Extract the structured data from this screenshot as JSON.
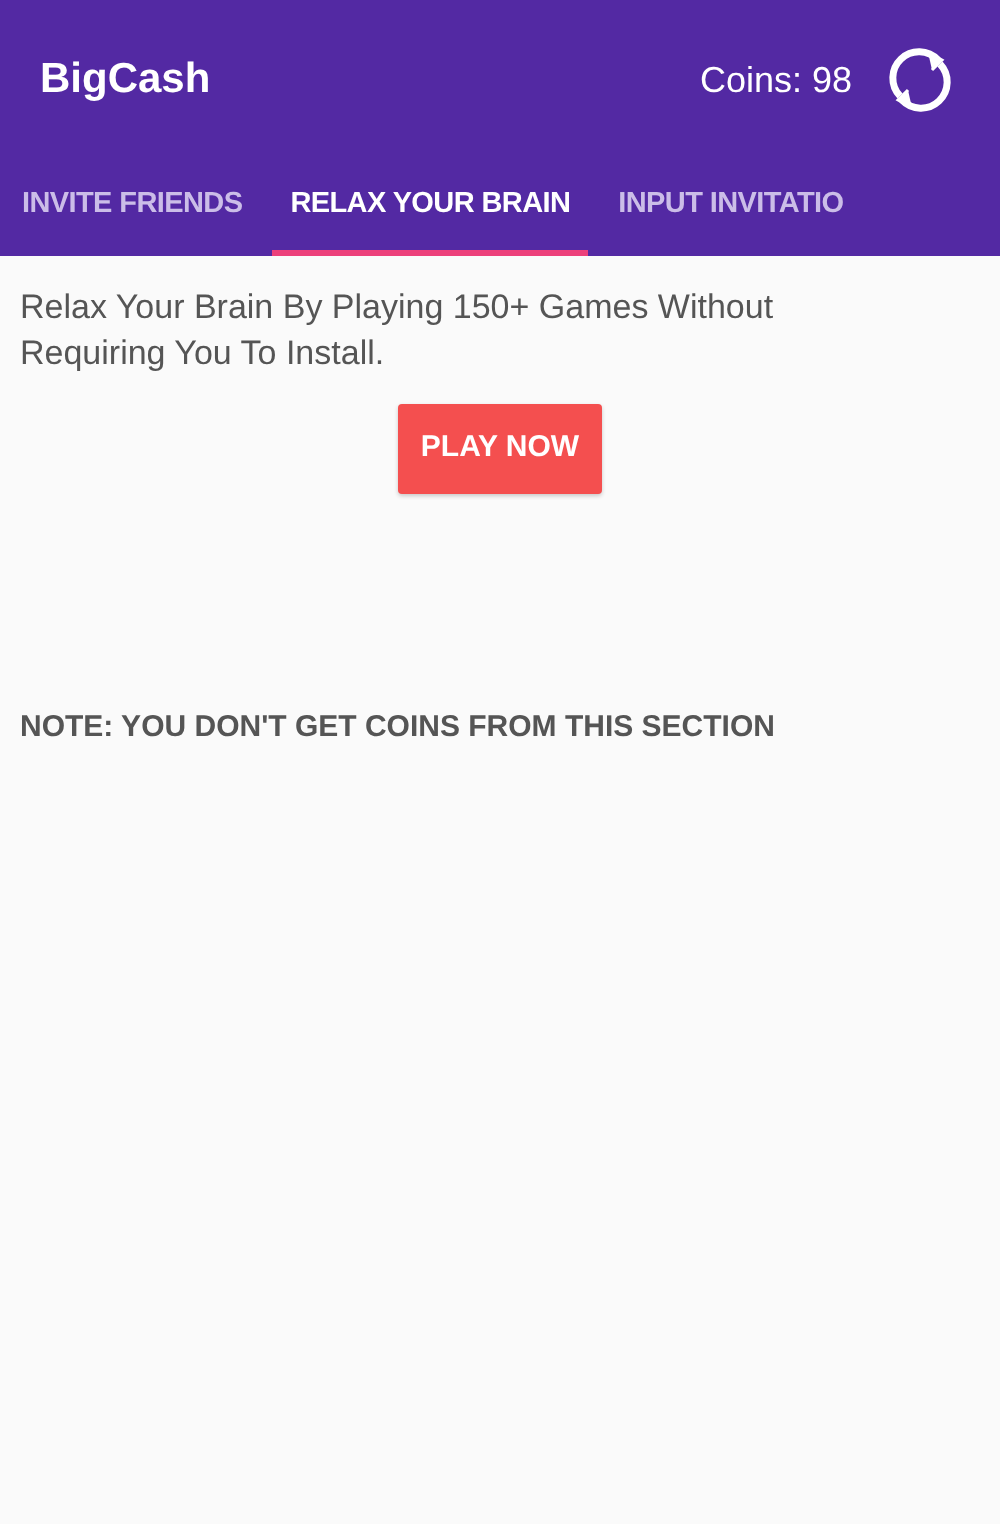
{
  "app_bar": {
    "title": "BigCash",
    "coins": "Coins: 98"
  },
  "tabs": [
    {
      "label": "INVITE FRIENDS",
      "selected": false
    },
    {
      "label": "RELAX YOUR BRAIN",
      "selected": true
    },
    {
      "label": "INPUT INVITATIO",
      "selected": false
    }
  ],
  "content": {
    "description": "Relax Your Brain By Playing 150+ Games Without Requiring You To Install.",
    "button": "PLAY NOW",
    "note": "NOTE: YOU DON'T GET COINS FROM THIS SECTION"
  }
}
